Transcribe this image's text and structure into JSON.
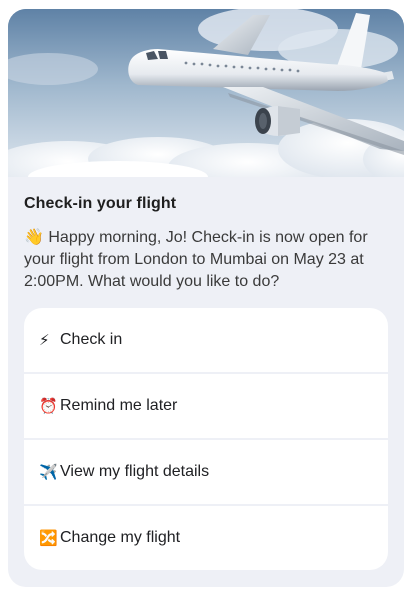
{
  "card": {
    "title": "Check-in your flight",
    "message_emoji": "👋",
    "message": "Happy morning, Jo! Check-in is now open for your flight from London to Mumbai on May 23 at 2:00PM. What would you like to do?",
    "hero_image": "airplane-above-clouds"
  },
  "options": [
    {
      "icon": "lightning-icon",
      "emoji": "⚡",
      "label": "Check in"
    },
    {
      "icon": "alarm-clock-icon",
      "emoji": "⏰",
      "label": "Remind me later"
    },
    {
      "icon": "airplane-icon",
      "emoji": "✈️",
      "label": "View my flight details"
    },
    {
      "icon": "shuffle-icon",
      "emoji": "🔀",
      "label": "Change my flight"
    }
  ],
  "colors": {
    "card_bg": "#eef0f6",
    "option_bg": "#ffffff",
    "text": "#202124"
  }
}
